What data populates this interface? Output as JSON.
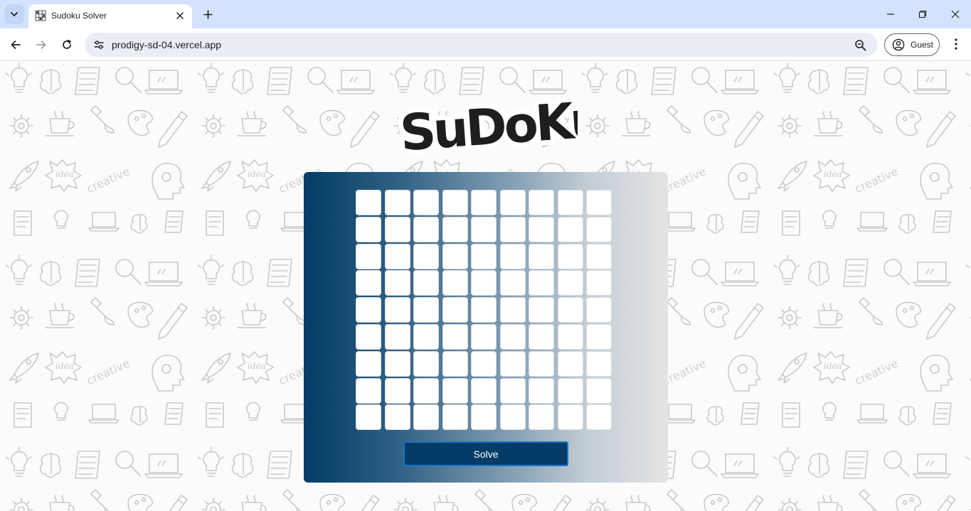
{
  "browser": {
    "tab_title": "Sudoku Solver",
    "url": "prodigy-sd-04.vercel.app",
    "profile_label": "Guest",
    "icons": {
      "tab_search": "chevron-down-icon",
      "favicon": "sudoku-favicon",
      "tab_close": "close-icon",
      "new_tab": "plus-icon",
      "minimize": "minimize-icon",
      "restore": "restore-icon",
      "close_window": "close-icon",
      "back": "arrow-left-icon",
      "forward": "arrow-right-icon",
      "reload": "reload-icon",
      "site_info": "tune-icon",
      "zoom": "zoom-out-icon",
      "profile": "account-icon",
      "menu": "kebab-menu-icon"
    },
    "colors": {
      "tabstrip": "#d3e3fd",
      "omnibox": "#e9eef6"
    }
  },
  "page": {
    "logo_text": "SuDoKu",
    "grid": {
      "rows": [
        [
          "",
          "",
          "",
          "",
          "",
          "",
          "",
          "",
          ""
        ],
        [
          "",
          "",
          "",
          "",
          "",
          "",
          "",
          "",
          ""
        ],
        [
          "",
          "",
          "",
          "",
          "",
          "",
          "",
          "",
          ""
        ],
        [
          "",
          "",
          "",
          "",
          "",
          "",
          "",
          "",
          ""
        ],
        [
          "",
          "",
          "",
          "",
          "",
          "",
          "",
          "",
          ""
        ],
        [
          "",
          "",
          "",
          "",
          "",
          "",
          "",
          "",
          ""
        ],
        [
          "",
          "",
          "",
          "",
          "",
          "",
          "",
          "",
          ""
        ],
        [
          "",
          "",
          "",
          "",
          "",
          "",
          "",
          "",
          ""
        ],
        [
          "",
          "",
          "",
          "",
          "",
          "",
          "",
          "",
          ""
        ]
      ]
    },
    "solve_label": "Solve",
    "background_doodle_words": [
      "idea",
      "creative"
    ],
    "colors": {
      "panel_start": "#033c66",
      "panel_end": "#e4e4e4",
      "button": "#033c66",
      "button_border": "#1a73c9"
    }
  }
}
